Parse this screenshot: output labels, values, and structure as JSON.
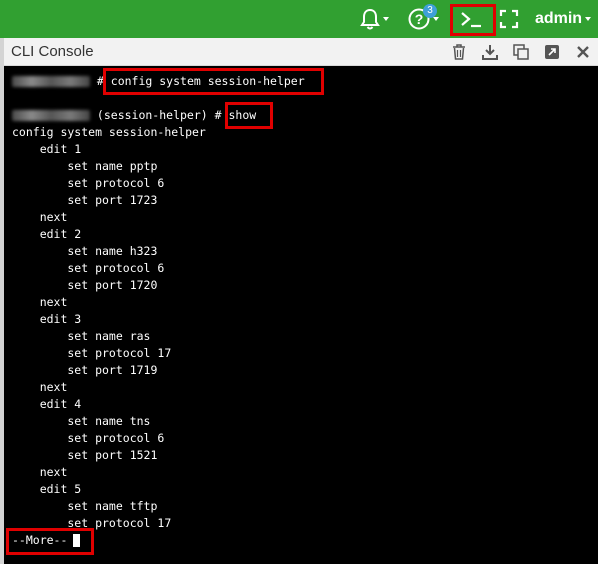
{
  "topbar": {
    "help_badge": "3",
    "user_label": "admin",
    "icons": [
      "bell-icon",
      "help-icon",
      "terminal-icon",
      "fullscreen-icon"
    ],
    "color": "#31a031"
  },
  "panel": {
    "title": "CLI Console",
    "icons": [
      "trash-icon",
      "download-icon",
      "copy-icon",
      "popout-icon",
      "close-icon"
    ]
  },
  "console": {
    "prompt_1_suffix": " # ",
    "command_1": "config system session-helper",
    "prompt_2_suffix": " (session-helper) # ",
    "command_2": "show",
    "output": [
      "config system session-helper",
      "    edit 1",
      "        set name pptp",
      "        set protocol 6",
      "        set port 1723",
      "    next",
      "    edit 2",
      "        set name h323",
      "        set protocol 6",
      "        set port 1720",
      "    next",
      "    edit 3",
      "        set name ras",
      "        set protocol 17",
      "        set port 1719",
      "    next",
      "    edit 4",
      "        set name tns",
      "        set protocol 6",
      "        set port 1521",
      "    next",
      "    edit 5",
      "        set name tftp",
      "        set protocol 17"
    ],
    "more_prompt": "--More--"
  },
  "highlight_color": "#e00000"
}
